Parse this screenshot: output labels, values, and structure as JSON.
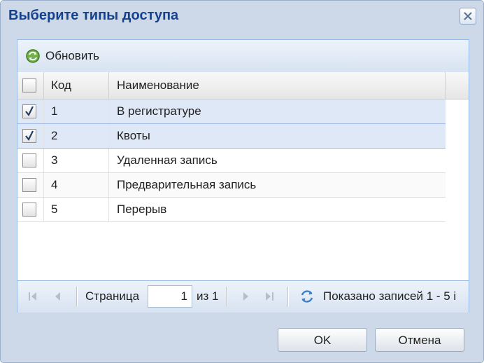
{
  "dialog": {
    "title": "Выберите типы доступа"
  },
  "toolbar": {
    "refresh_label": "Обновить"
  },
  "grid": {
    "columns": [
      "Код",
      "Наименование"
    ],
    "rows": [
      {
        "code": "1",
        "name": "В регистратуре",
        "checked": true
      },
      {
        "code": "2",
        "name": "Квоты",
        "checked": true
      },
      {
        "code": "3",
        "name": "Удаленная запись",
        "checked": false
      },
      {
        "code": "4",
        "name": "Предварительная запись",
        "checked": false
      },
      {
        "code": "5",
        "name": "Перерыв",
        "checked": false
      }
    ]
  },
  "pager": {
    "page_label": "Страница",
    "page_value": "1",
    "of_label": "из 1",
    "records_info": "Показано записей 1 - 5 і"
  },
  "buttons": {
    "ok_label": "OK",
    "cancel_label": "Отмена"
  },
  "colors": {
    "title": "#15428b",
    "window_bg": "#cdd9e8",
    "selected_row": "#dfe8f6"
  }
}
